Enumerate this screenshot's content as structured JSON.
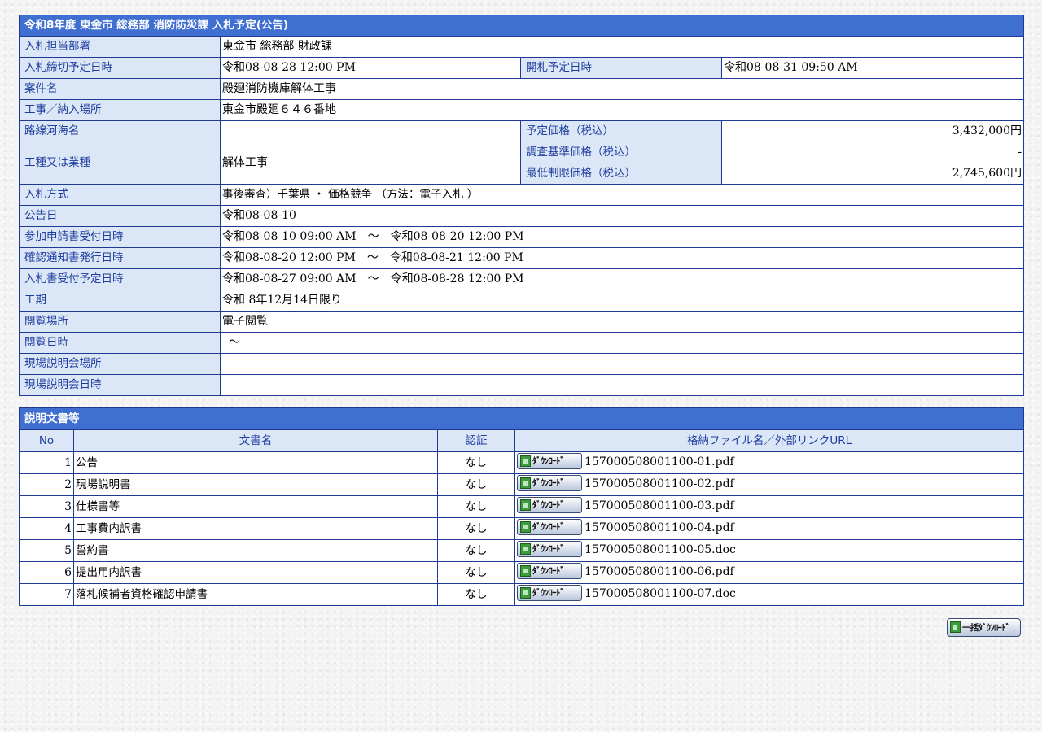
{
  "header": {
    "title": "令和8年度  東金市  総務部  消防防災課  入札予定(公告)"
  },
  "info": {
    "dept_label": "入札担当部署",
    "dept_value": "東金市  総務部  財政課",
    "deadline_label": "入札締切予定日時",
    "deadline_value": "令和08-08-28 12:00 PM",
    "open_label": "開札予定日時",
    "open_value": "令和08-08-31 09:50 AM",
    "case_label": "案件名",
    "case_value": "殿廻消防機庫解体工事",
    "place_label": "工事／納入場所",
    "place_value": "東金市殿廻６４６番地",
    "route_label": "路線河海名",
    "route_value": "",
    "price_label": "予定価格（税込）",
    "price_value": "3,432,000円",
    "type_label": "工種又は業種",
    "type_value": "解体工事",
    "survey_label": "調査基準価格（税込）",
    "survey_value": "-",
    "min_label": "最低制限価格（税込）",
    "min_value": "2,745,600円",
    "method_label": "入札方式",
    "method_value": "事後審査）千葉県 ・ 価格競争 （方法：電子入札 ）",
    "notice_label": "公告日",
    "notice_value": "令和08-08-10",
    "apply_label": "参加申請書受付日時",
    "apply_value": "令和08-08-10 09:00 AM　～　令和08-08-20 12:00 PM",
    "confirm_label": "確認通知書発行日時",
    "confirm_value": "令和08-08-20 12:00 PM　～　令和08-08-21 12:00 PM",
    "bid_label": "入札書受付予定日時",
    "bid_value": "令和08-08-27 09:00 AM　～　令和08-08-28 12:00 PM",
    "period_label": "工期",
    "period_value": "令和 8年12月14日限り",
    "view_place_label": "閲覧場所",
    "view_place_value": "電子閲覧",
    "view_time_label": "閲覧日時",
    "view_time_value": "～",
    "site_place_label": "現場説明会場所",
    "site_place_value": "",
    "site_time_label": "現場説明会日時",
    "site_time_value": ""
  },
  "docs": {
    "title": "説明文書等",
    "col_no": "No",
    "col_name": "文書名",
    "col_auth": "認証",
    "col_file": "格納ファイル名／外部リンクURL",
    "download_label": "ﾀﾞｳﾝﾛｰﾄﾞ",
    "rows": [
      {
        "no": "1",
        "name": "公告",
        "auth": "なし",
        "file": "157000508001100-01.pdf"
      },
      {
        "no": "2",
        "name": "現場説明書",
        "auth": "なし",
        "file": "157000508001100-02.pdf"
      },
      {
        "no": "3",
        "name": "仕様書等",
        "auth": "なし",
        "file": "157000508001100-03.pdf"
      },
      {
        "no": "4",
        "name": "工事費内訳書",
        "auth": "なし",
        "file": "157000508001100-04.pdf"
      },
      {
        "no": "5",
        "name": "誓約書",
        "auth": "なし",
        "file": "157000508001100-05.doc"
      },
      {
        "no": "6",
        "name": "提出用内訳書",
        "auth": "なし",
        "file": "157000508001100-06.pdf"
      },
      {
        "no": "7",
        "name": "落札候補者資格確認申請書",
        "auth": "なし",
        "file": "157000508001100-07.doc"
      }
    ]
  },
  "bulk_download_label": "一括ﾀﾞｳﾝﾛｰﾄﾞ"
}
